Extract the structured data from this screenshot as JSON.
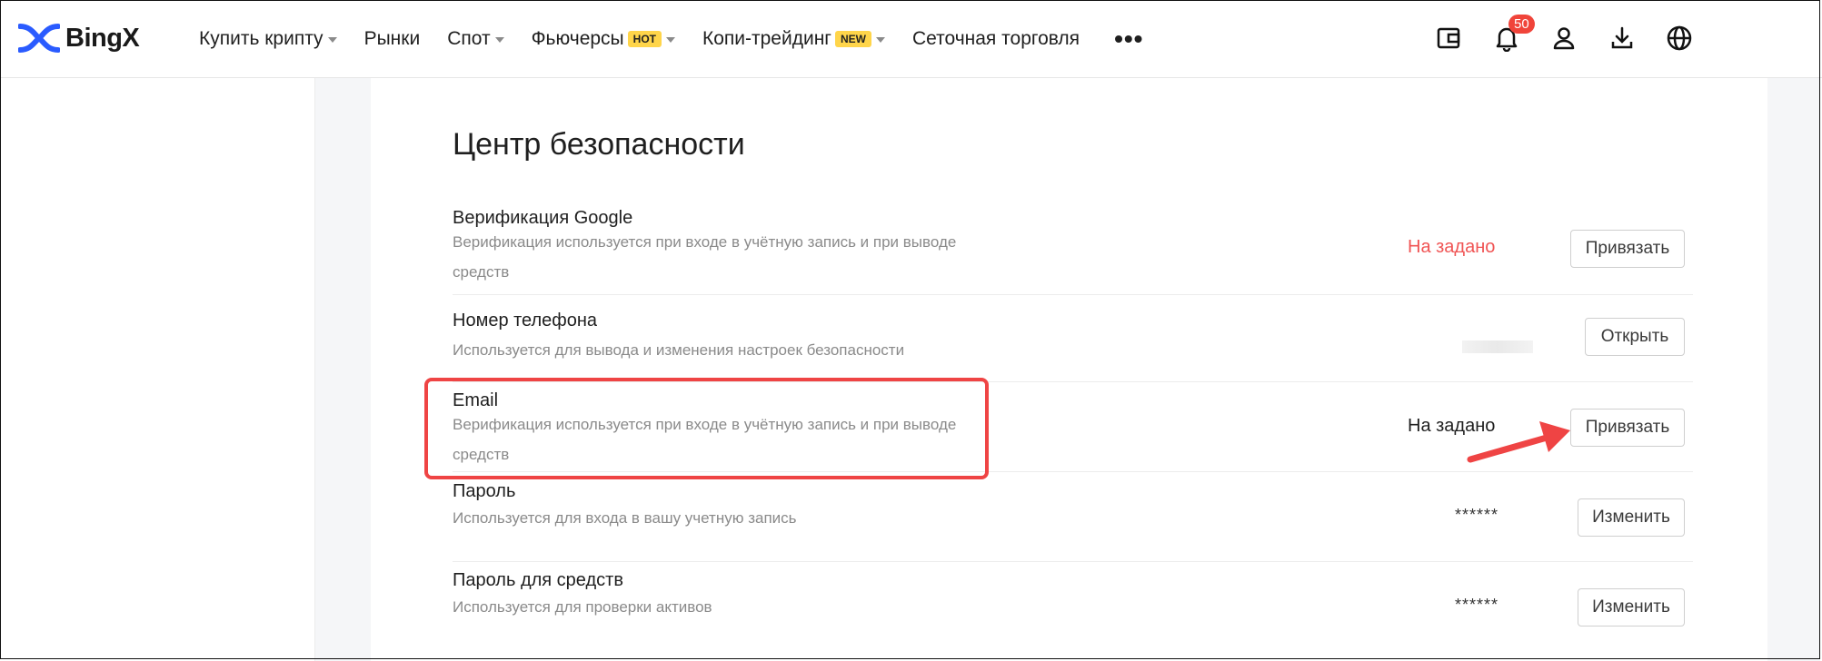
{
  "brand": {
    "name": "BingX",
    "logo_color": "#2a5bff"
  },
  "nav": {
    "items": [
      {
        "label": "Купить крипту",
        "caret": true
      },
      {
        "label": "Рынки"
      },
      {
        "label": "Спот",
        "caret": true
      },
      {
        "label": "Фьючерсы",
        "badge": "HOT",
        "caret": true
      },
      {
        "label": "Копи-трейдинг",
        "badge": "NEW",
        "caret": true
      },
      {
        "label": "Сеточная торговля"
      }
    ],
    "more_label": "•••",
    "icons": [
      "wallet-icon",
      "bell-icon",
      "user-icon",
      "download-icon",
      "globe-icon"
    ],
    "notifications_count": "50"
  },
  "security": {
    "title": "Центр безопасности",
    "rows": [
      {
        "title": "Верификация Google",
        "description": "Верификация используется при входе в учётную запись и при выводе средств",
        "status": "На задано",
        "status_color": "#f05454",
        "button": "Привязать"
      },
      {
        "title": "Номер телефона",
        "description": "Используется для вывода и изменения настроек безопасности",
        "status": "",
        "button": "Открыть"
      },
      {
        "title": "Email",
        "description": "Верификация используется при входе в учётную запись и при выводе средств",
        "status": "На задано",
        "button": "Привязать"
      },
      {
        "title": "Пароль",
        "description": "Используется для входа в вашу учетную запись",
        "status": "******",
        "button": "Изменить"
      },
      {
        "title": "Пароль для средств",
        "description": "Используется для проверки активов",
        "status": "******",
        "button": "Изменить"
      }
    ]
  },
  "annotation_color": "#ef4444"
}
